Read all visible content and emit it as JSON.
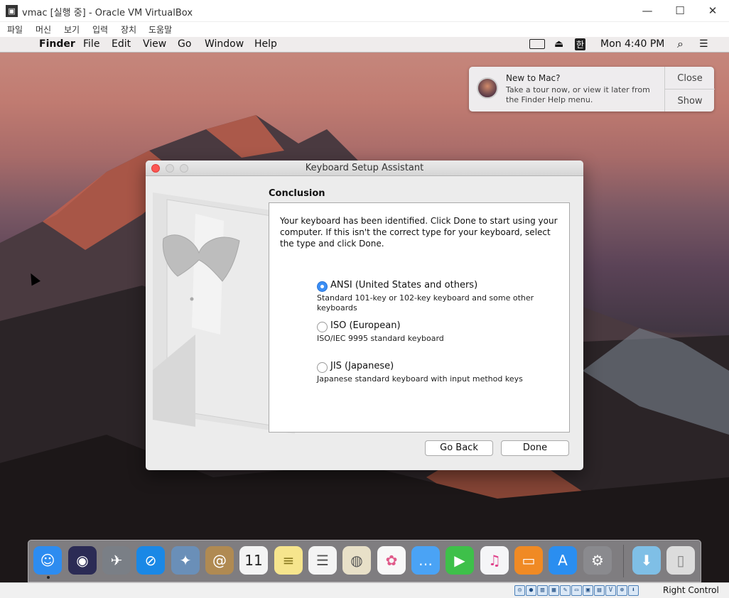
{
  "host": {
    "title": "vmac [실행 중] - Oracle VM VirtualBox",
    "logo_glyph": "▣",
    "buttons": {
      "minimize": "—",
      "maximize": "☐",
      "close": "✕"
    },
    "menu": [
      "파일",
      "머신",
      "보기",
      "입력",
      "장치",
      "도움말"
    ],
    "status_icons": [
      "◎",
      "●",
      "▥",
      "▦",
      "✎",
      "▭",
      "▣",
      "▤",
      "V",
      "⊕",
      "⬇"
    ],
    "host_key": "Right Control"
  },
  "mac_menubar": {
    "apple": "",
    "app": "Finder",
    "items": [
      "File",
      "Edit",
      "View",
      "Go",
      "Window",
      "Help"
    ],
    "input_source": "한",
    "eject": "⏏",
    "clock": "Mon 4:40 PM",
    "search": "⌕",
    "list": "☰"
  },
  "notification": {
    "title": "New to Mac?",
    "body": "Take a tour now, or view it later from the Finder Help menu.",
    "close": "Close",
    "show": "Show"
  },
  "dialog": {
    "title": "Keyboard Setup Assistant",
    "heading": "Conclusion",
    "intro": "Your keyboard has been identified. Click Done to start using your computer. If this isn't the correct type for your keyboard, select the type and click Done.",
    "options": [
      {
        "label": "ANSI (United States and others)",
        "desc": "Standard 101-key or 102-key keyboard and some other keyboards",
        "selected": true
      },
      {
        "label": "ISO (European)",
        "desc": "ISO/IEC 9995 standard keyboard",
        "selected": false
      },
      {
        "label": "JIS (Japanese)",
        "desc": "Japanese standard keyboard with input method keys",
        "selected": false
      }
    ],
    "go_back": "Go Back",
    "done": "Done",
    "colors": {
      "close": "#fc5753",
      "minimize": "#d8d8d8",
      "zoom": "#d8d8d8",
      "radio_selected": "#3b8ef5"
    }
  },
  "dock": {
    "apps": [
      {
        "name": "Finder",
        "glyph": "☺",
        "color": "#2d8cf0"
      },
      {
        "name": "Siri",
        "glyph": "◉",
        "color": "#2b2b55"
      },
      {
        "name": "Launchpad",
        "glyph": "✈",
        "color": "#7a7f86"
      },
      {
        "name": "Safari",
        "glyph": "⊘",
        "color": "#1a88e6"
      },
      {
        "name": "Preview",
        "glyph": "✦",
        "color": "#6a8fb8"
      },
      {
        "name": "Contacts",
        "glyph": "@",
        "color": "#b08a52"
      },
      {
        "name": "Calendar",
        "glyph": "11",
        "color": "#f4f4f4"
      },
      {
        "name": "Notes",
        "glyph": "≡",
        "color": "#f6e58d"
      },
      {
        "name": "Reminders",
        "glyph": "☰",
        "color": "#f4f4f4"
      },
      {
        "name": "Photo Booth",
        "glyph": "◍",
        "color": "#e8e0c8"
      },
      {
        "name": "Photos",
        "glyph": "✿",
        "color": "#f8f8f8"
      },
      {
        "name": "Messages",
        "glyph": "…",
        "color": "#4aa3f5"
      },
      {
        "name": "FaceTime",
        "glyph": "▶",
        "color": "#3ec04a"
      },
      {
        "name": "iTunes",
        "glyph": "♫",
        "color": "#f5f5f7"
      },
      {
        "name": "iBooks",
        "glyph": "▭",
        "color": "#f08a24"
      },
      {
        "name": "App Store",
        "glyph": "A",
        "color": "#2a8ef0"
      },
      {
        "name": "System Preferences",
        "glyph": "⚙",
        "color": "#8a8a8e"
      },
      {
        "name": "Downloads",
        "glyph": "⬇",
        "color": "#7fbfe6"
      },
      {
        "name": "Trash",
        "glyph": "▯",
        "color": "#dcdcdc"
      }
    ]
  }
}
